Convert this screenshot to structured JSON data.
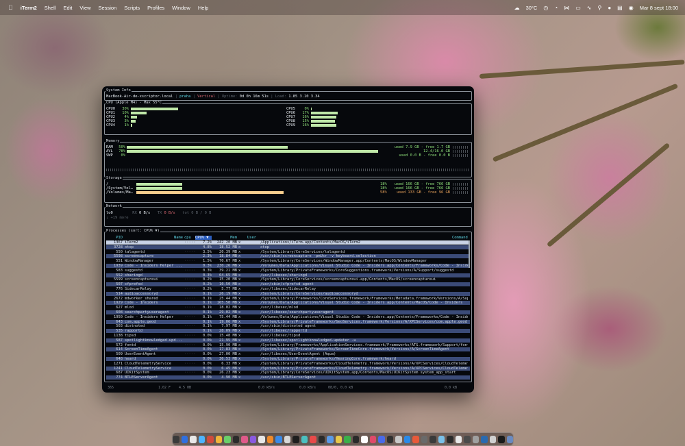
{
  "menubar": {
    "app_name": "iTerm2",
    "menus": [
      "Shell",
      "Edit",
      "View",
      "Session",
      "Scripts",
      "Profiles",
      "Window",
      "Help"
    ],
    "weather": "30°C",
    "datetime": "Mar 8 sept 18:00"
  },
  "sysinfo": {
    "section": "System Info",
    "host": "MacBook-Air-de-xscriptor.local",
    "user": "praha",
    "layout": "Vertical",
    "uptime_label": "Uptime:",
    "uptime": "0d 0h 16m 51s",
    "load_label": "Load:",
    "load": "1.85 3.10 3.34"
  },
  "cpu": {
    "section": "CPU (Apple M4) - Max 55°C",
    "cores": [
      {
        "label": "CPU0",
        "pct": "30%",
        "fill": 0.3
      },
      {
        "label": "CPU1",
        "pct": "10%",
        "fill": 0.1
      },
      {
        "label": "CPU2",
        "pct": "4%",
        "fill": 0.04
      },
      {
        "label": "CPU3",
        "pct": "3%",
        "fill": 0.03
      },
      {
        "label": "CPU4",
        "pct": "1%",
        "fill": 0.01
      },
      {
        "label": "CPU5",
        "pct": "0%",
        "fill": 0.0
      },
      {
        "label": "CPU6",
        "pct": "17%",
        "fill": 0.17
      },
      {
        "label": "CPU7",
        "pct": "16%",
        "fill": 0.16
      },
      {
        "label": "CPU8",
        "pct": "15%",
        "fill": 0.15
      },
      {
        "label": "CPU9",
        "pct": "16%",
        "fill": 0.16
      }
    ]
  },
  "memory": {
    "section": "Memory",
    "rows": [
      {
        "label": "RAM",
        "pct": "50%",
        "fill": 0.5,
        "info": "used 7.9 GB - free 1.7 GB"
      },
      {
        "label": "AVL",
        "pct": "78%",
        "fill": 0.78,
        "info": "12.4/16.0 GB"
      },
      {
        "label": "SWP",
        "pct": "0%",
        "fill": 0.0,
        "info": "used 0.0 B - free 0.0 B"
      }
    ]
  },
  "storage": {
    "section": "Storage",
    "rows": [
      {
        "label": "/",
        "pct": "18%",
        "fill": 0.18,
        "info": "used 166 GB - free 766 GB"
      },
      {
        "label": "/System/Vol…",
        "pct": "18%",
        "fill": 0.18,
        "info": "used 166 GB - free 766 GB"
      },
      {
        "label": "/Volumes/Ma…",
        "pct": "58%",
        "fill": 0.58,
        "info": "used 133 GB - free 96 GB"
      }
    ]
  },
  "network": {
    "section": "Network",
    "iface": "lo0",
    "rx_label": "RX",
    "rx": "0 B/s",
    "tx_label": "TX",
    "tx": "0 B/s",
    "tot": "tot 0 B / 0 B",
    "more": "↓ +19 more"
  },
  "processes": {
    "section": "Processes (sort: CPU% ▼)",
    "headers": {
      "pid": "PID",
      "name": "Name",
      "cpu": "cpu",
      "pct": "CPU% ▼",
      "mem": "Mem",
      "user": "User",
      "cmd": "Command"
    },
    "rows": [
      {
        "pid": "1367",
        "name": "iTerm2",
        "pct": "7.2%",
        "mem": "242.20 MB",
        "user": "x",
        "cmd": "/Applications/iTerm.app/Contents/MacOS/iTerm2"
      },
      {
        "pid": "3728",
        "name": "xtop",
        "pct": "4.8%",
        "mem": "18.52 MB",
        "user": "x",
        "cmd": "xtop"
      },
      {
        "pid": "550",
        "name": "talagentd",
        "pct": "3.5%",
        "mem": "20.39 MB",
        "user": "x",
        "cmd": "/System/Library/CoreServices/talagentd"
      },
      {
        "pid": "5598",
        "name": "screencapture",
        "pct": "2.3%",
        "mem": "18.84 MB",
        "user": "x",
        "cmd": "/usr/sbin/screencapture -pmUsr -v keyboard.selection"
      },
      {
        "pid": "551",
        "name": "WindowManager",
        "pct": "1.5%",
        "mem": "70.67 MB",
        "user": "x",
        "cmd": "/System/Library/CoreServices/WindowManager.app/Contents/MacOS/WindowManager"
      },
      {
        "pid": "1939",
        "name": "Code - Insiders Helper ...",
        "pct": "0.3%",
        "mem": "230.26 MB",
        "user": "x",
        "cmd": "/Volumes/Data/Applications/Visual Studio Code - Insiders.app/Contents/Frameworks/Code - Insiders"
      },
      {
        "pid": "583",
        "name": "suggestd",
        "pct": "0.3%",
        "mem": "39.21 MB",
        "user": "x",
        "cmd": "/System/Library/PrivateFrameworks/CoreSuggestions.framework/Versions/A/Support/suggestd"
      },
      {
        "pid": "552",
        "name": "sharingd",
        "pct": "0.3%",
        "mem": "64.65 MB",
        "user": "x",
        "cmd": "/usr/libexec/sharingd"
      },
      {
        "pid": "5599",
        "name": "screencaptureui",
        "pct": "0.2%",
        "mem": "15.20 MB",
        "user": "x",
        "cmd": "/System/Library/CoreServices/screencaptureui.app/Contents/MacOS/screencaptureui"
      },
      {
        "pid": "507",
        "name": "cfprefsd",
        "pct": "0.2%",
        "mem": "10.50 MB",
        "user": "x",
        "cmd": "/usr/sbin/cfprefsd agent"
      },
      {
        "pid": "776",
        "name": "SidecarRelay",
        "pct": "0.2%",
        "mem": "5.77 MB",
        "user": "x",
        "cmd": "/usr/libexec/SidecarRelay"
      },
      {
        "pid": "514",
        "name": "audioaccessoryd",
        "pct": "0.1%",
        "mem": "26.19 MB",
        "user": "x",
        "cmd": "/System/Library/CoreServices/audioaccessoryd"
      },
      {
        "pid": "2672",
        "name": "mdworker_shared",
        "pct": "0.1%",
        "mem": "25.44 MB",
        "user": "x",
        "cmd": "/System/Library/Frameworks/CoreServices.framework/Frameworks/Metadata.framework/Versions/A/Support"
      },
      {
        "pid": "1929",
        "name": "Code - Insiders",
        "pct": "0.1%",
        "mem": "165.50 MB",
        "user": "x",
        "cmd": "/Volumes/Data/Applications/Visual Studio Code - Insiders.app/Contents/MacOS/Code - Insiders"
      },
      {
        "pid": "627",
        "name": "mlod",
        "pct": "0.1%",
        "mem": "18.02 MB",
        "user": "x",
        "cmd": "/usr/libexec/mlod"
      },
      {
        "pid": "608",
        "name": "searchpartyuseragent",
        "pct": "0.1%",
        "mem": "29.02 MB",
        "user": "x",
        "cmd": "/usr/libexec/searchpartyuseragent"
      },
      {
        "pid": "1950",
        "name": "Code - Insiders Helper",
        "pct": "0.1%",
        "mem": "75.44 MB",
        "user": "x",
        "cmd": "/Volumes/Data/Applications/Visual Studio Code - Insiders.app/Contents/Frameworks/Code - Insiders"
      },
      {
        "pid": "643",
        "name": "com.apple.geod",
        "pct": "0.1%",
        "mem": "19.06 MB",
        "user": "x",
        "cmd": "/System/Library/PrivateFrameworks/GeoServices.framework/Versions/A/XPCServices/com.apple.geod.xpc"
      },
      {
        "pid": "503",
        "name": "distnoted",
        "pct": "0.1%",
        "mem": "7.97 MB",
        "user": "x",
        "cmd": "/usr/sbin/distnoted agent"
      },
      {
        "pid": "535",
        "name": "rapportd",
        "pct": "0.1%",
        "mem": "28.09 MB",
        "user": "x",
        "cmd": "/usr/libexec/rapportd"
      },
      {
        "pid": "1138",
        "name": "tipsd",
        "pct": "0.0%",
        "mem": "15.48 MB",
        "user": "x",
        "cmd": "/usr/libexec/tipsd"
      },
      {
        "pid": "587",
        "name": "spotlightknowledged.upd...",
        "pct": "0.0%",
        "mem": "21.95 MB",
        "user": "x",
        "cmd": "/usr/libexec/spotlightknowledged.updater -u"
      },
      {
        "pid": "572",
        "name": "fontd",
        "pct": "0.0%",
        "mem": "15.90 MB",
        "user": "x",
        "cmd": "/System/Library/Frameworks/ApplicationServices.framework/Frameworks/ATS.framework/Support/fontd"
      },
      {
        "pid": "614",
        "name": "ScreenTimeAgent",
        "pct": "0.0%",
        "mem": "17.83 MB",
        "user": "x",
        "cmd": "/System/Library/PrivateFrameworks/ScreenTimeCore.framework/Versions/A/ScreenTimeAgent"
      },
      {
        "pid": "509",
        "name": "UserEventAgent",
        "pct": "0.0%",
        "mem": "27.00 MB",
        "user": "x",
        "cmd": "/usr/libexec/UserEventAgent (Aqua)"
      },
      {
        "pid": "648",
        "name": "heard",
        "pct": "0.0%",
        "mem": "36.53 MB",
        "user": "x",
        "cmd": "/System/Library/PrivateFrameworks/HearingCore.framework/heard"
      },
      {
        "pid": "1271",
        "name": "CloudTelemetryService",
        "pct": "0.0%",
        "mem": "6.33 MB",
        "user": "x",
        "cmd": "/System/Library/PrivateFrameworks/CloudTelemetry.framework/Versions/A/XPCServices/CloudTelemetryService"
      },
      {
        "pid": "1241",
        "name": "CloudTelemetryService",
        "pct": "0.0%",
        "mem": "6.45 MB",
        "user": "x",
        "cmd": "/System/Library/PrivateFrameworks/CloudTelemetry.framework/Versions/A/XPCServices/CloudTelemetryService"
      },
      {
        "pid": "687",
        "name": "UIKitSystem",
        "pct": "0.0%",
        "mem": "26.23 MB",
        "user": "x",
        "cmd": "/System/Library/CoreServices/UIKitSystem.app/Contents/MacOS/UIKitSystem system_app_start"
      },
      {
        "pid": "774",
        "name": "BTLEServerAgent",
        "pct": "0.0%",
        "mem": "4.90 MB",
        "user": "x",
        "cmd": "/usr/sbin/BTLEServerAgent"
      }
    ]
  },
  "statusbar": {
    "items": [
      "365",
      "1.02 F",
      "4.5 0B",
      "0.0 kB/s",
      "0.0 kB/s",
      "08/0, 0.0 kB",
      "0.0 kB"
    ]
  },
  "dock": {
    "colors": [
      "#3a3a3a",
      "#2f6fe0",
      "#e8e8e8",
      "#4db4ff",
      "#d04a3c",
      "#f0b43a",
      "#6ad06a",
      "#2b2b2b",
      "#e05a8a",
      "#8a5ae0",
      "#e8e8e8",
      "#f08a2a",
      "#3a8ae8",
      "#d8d8d8",
      "#1e1e1e",
      "#4ac0c0",
      "#e84a4a",
      "#2a2a2a",
      "#5a9ae8",
      "#e8c84a",
      "#3ab04a",
      "#2a2a2a",
      "#ffffff",
      "#e04a6a",
      "#4a6ae8",
      "#303030",
      "#c8c8c8",
      "#2a8ae8",
      "#e85a3a",
      "#6a6a6a",
      "#3a3a3a",
      "#7ac0e8",
      "#2a2a2a",
      "#e8e8e8",
      "#4a4a4a",
      "#a0a0a0",
      "#2a6ab0",
      "#d0d0d0",
      "#1a1a1a",
      "#6a8ac0"
    ]
  }
}
